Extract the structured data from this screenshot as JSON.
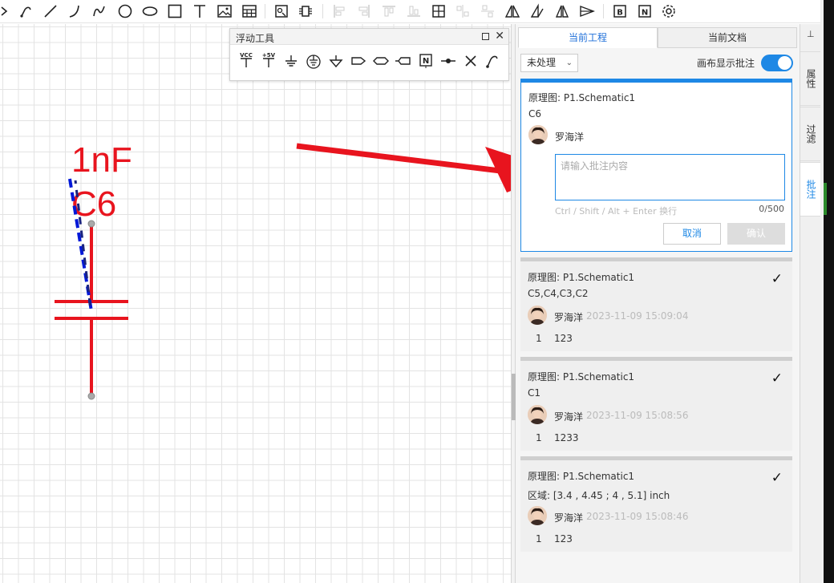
{
  "toolbar": {
    "icons": [
      "pin-icon",
      "line-icon",
      "arc-icon",
      "bezier-icon",
      "circle-icon",
      "ellipse-icon",
      "rectangle-icon",
      "text-icon",
      "image-icon",
      "table-icon",
      "component-icon",
      "netlabel-icon",
      "align-left-icon",
      "align-right-icon",
      "align-top-icon",
      "align-bottom-icon",
      "grid-icon",
      "distribute-h-icon",
      "distribute-v-icon",
      "flip-h-icon",
      "flip-v-icon",
      "mirror-icon",
      "send-icon",
      "bom-icon",
      "netlist-icon",
      "settings-icon"
    ]
  },
  "floating_tools": {
    "title": "浮动工具",
    "items": [
      {
        "icon": "vcc-icon",
        "label": "VCC"
      },
      {
        "icon": "plus5v-icon",
        "label": "+5V"
      },
      {
        "icon": "ground-icon"
      },
      {
        "icon": "earth-ground-icon"
      },
      {
        "icon": "signal-ground-icon"
      },
      {
        "icon": "net-port-right-icon"
      },
      {
        "icon": "net-port-both-icon"
      },
      {
        "icon": "net-port-left-icon"
      },
      {
        "icon": "netlabel-icon",
        "label": "N"
      },
      {
        "icon": "junction-icon"
      },
      {
        "icon": "no-connect-icon"
      },
      {
        "icon": "wire-pen-icon"
      }
    ]
  },
  "schematic": {
    "value_label": "1nF",
    "designator": "C6",
    "component_color": "#e8141e",
    "arrow_color": "#e8141e",
    "selection_color": "#1035c8"
  },
  "right_panel": {
    "tabs": [
      {
        "label": "当前工程",
        "active": true
      },
      {
        "label": "当前文档",
        "active": false
      }
    ],
    "filter": {
      "selected": "未处理"
    },
    "toggle_label": "画布显示批注",
    "toggle_on": true,
    "active_card": {
      "doc": "原理图: P1.Schematic1",
      "target": "C6",
      "user": "罗海洋",
      "placeholder": "请输入批注内容",
      "hint": "Ctrl / Shift / Alt + Enter 换行",
      "counter": "0/500",
      "cancel": "取消",
      "confirm": "确认"
    },
    "cards": [
      {
        "doc": "原理图: P1.Schematic1",
        "target": "C5,C4,C3,C2",
        "user": "罗海洋",
        "time": "2023-11-09 15:09:04",
        "reply_index": "1",
        "reply": "123"
      },
      {
        "doc": "原理图: P1.Schematic1",
        "target": "C1",
        "user": "罗海洋",
        "time": "2023-11-09 15:08:56",
        "reply_index": "1",
        "reply": "1233"
      },
      {
        "doc": "原理图: P1.Schematic1",
        "target": "区域: [3.4 , 4.45 ; 4 , 5.1] inch",
        "user": "罗海洋",
        "time": "2023-11-09 15:08:46",
        "reply_index": "1",
        "reply": "123"
      }
    ],
    "check_mark": "✓"
  },
  "side_tabs": [
    {
      "label": "属性",
      "active": false
    },
    {
      "label": "过滤",
      "active": false
    },
    {
      "label": "批注",
      "active": true
    }
  ],
  "side_pin": "📌"
}
